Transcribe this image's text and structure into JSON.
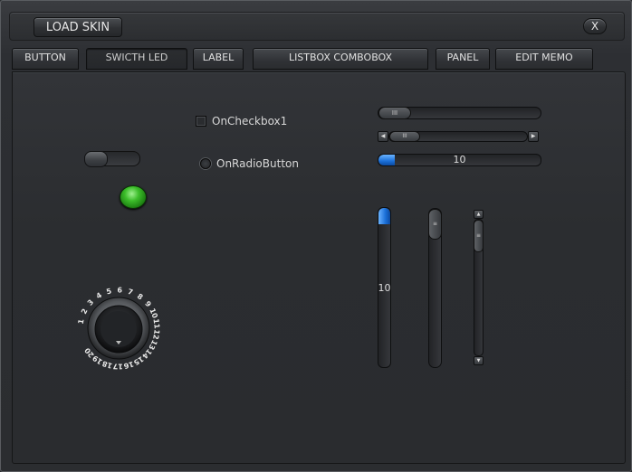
{
  "titlebar": {
    "load_skin_label": "LOAD SKIN",
    "close_label": "X"
  },
  "tabs": [
    {
      "label": "BUTTON",
      "active": false
    },
    {
      "label": "SWICTH LED",
      "active": true
    },
    {
      "label": "LABEL",
      "active": false
    },
    {
      "label": "LISTBOX COMBOBOX",
      "active": false
    },
    {
      "label": "PANEL",
      "active": false
    },
    {
      "label": "EDIT MEMO",
      "active": false
    }
  ],
  "controls": {
    "switch_state": "off",
    "led_color": "#3cbd2a",
    "checkbox_label": "OnCheckbox1",
    "checkbox_checked": false,
    "radio_label": "OnRadioButton",
    "radio_checked": false,
    "thumb_grip": "III",
    "progress_h": {
      "text": "10",
      "fraction": 0.1
    },
    "progress_v": {
      "text": "10",
      "fraction": 0.1
    },
    "dial_numbers": [
      "1",
      "2",
      "3",
      "4",
      "5",
      "6",
      "7",
      "8",
      "9",
      "10",
      "11",
      "12",
      "13",
      "14",
      "15",
      "16",
      "17",
      "18",
      "19",
      "20"
    ],
    "accent_color": "#1a6fd8"
  }
}
